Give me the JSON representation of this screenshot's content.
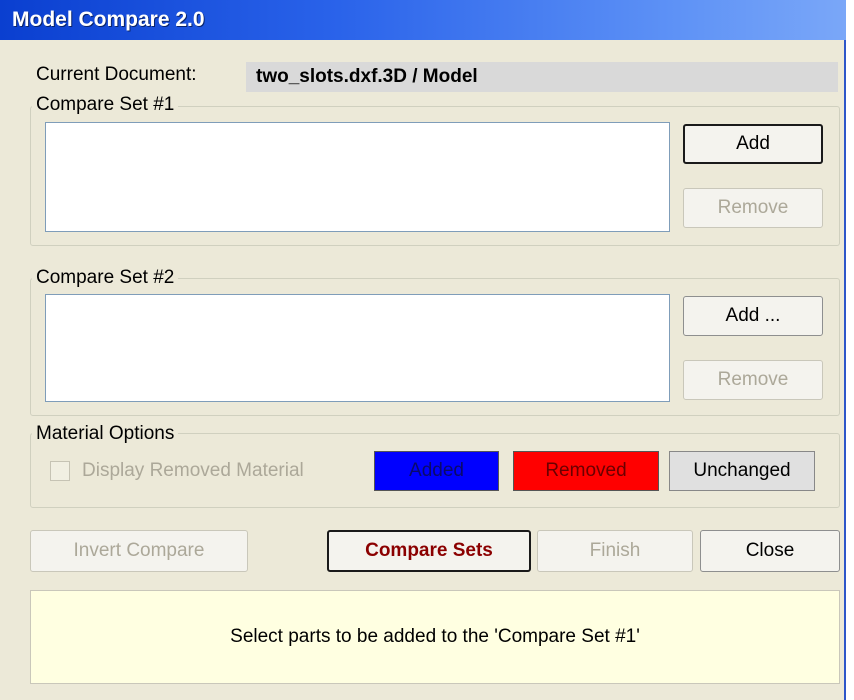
{
  "window": {
    "title": "Model Compare 2.0"
  },
  "document": {
    "label": "Current Document:",
    "value": "two_slots.dxf.3D / Model"
  },
  "compare_set_1": {
    "title": "Compare Set #1",
    "add_label": "Add",
    "remove_label": "Remove"
  },
  "compare_set_2": {
    "title": "Compare Set #2",
    "add_label": "Add ...",
    "remove_label": "Remove"
  },
  "material_options": {
    "title": "Material Options",
    "display_removed_label": "Display Removed Material",
    "display_removed_checked": false,
    "added_label": "Added",
    "removed_label": "Removed",
    "unchanged_label": "Unchanged",
    "colors": {
      "added": "#0000ff",
      "removed": "#ff0000",
      "unchanged": "#e0e0e0"
    }
  },
  "actions": {
    "invert_label": "Invert Compare",
    "compare_label": "Compare Sets",
    "finish_label": "Finish",
    "close_label": "Close"
  },
  "status": {
    "message": "Select parts to be added to the 'Compare Set #1'"
  }
}
